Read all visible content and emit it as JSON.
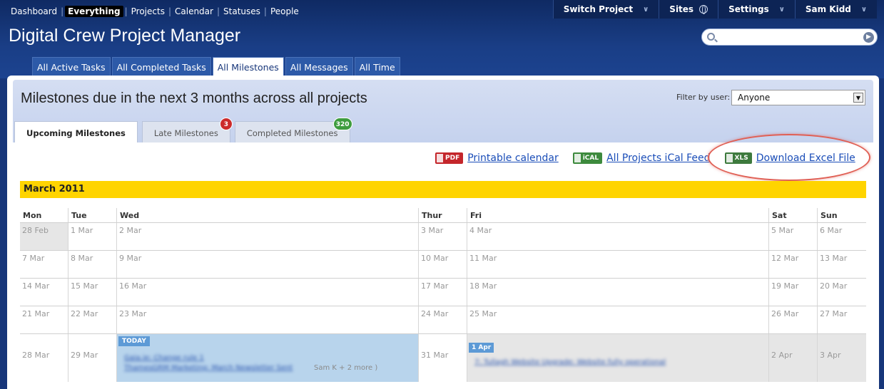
{
  "topnav": {
    "items": [
      "Dashboard",
      "Everything",
      "Projects",
      "Calendar",
      "Statuses",
      "People"
    ],
    "active_index": 1
  },
  "rightnav": {
    "switch_project": "Switch Project",
    "sites": "Sites",
    "settings": "Settings",
    "user": "Sam Kidd"
  },
  "app": {
    "title": "Digital Crew Project Manager"
  },
  "search": {
    "placeholder": ""
  },
  "tabs": [
    "All Active Tasks",
    "All Completed Tasks",
    "All Milestones",
    "All Messages",
    "All Time"
  ],
  "active_tab": 2,
  "page": {
    "title": "Milestones due in the next 3 months across all projects",
    "filter_label": "Filter by user:",
    "filter_value": "Anyone"
  },
  "subtabs": [
    {
      "label": "Upcoming Milestones",
      "badge": ""
    },
    {
      "label": "Late Milestones",
      "badge": "3"
    },
    {
      "label": "Completed Milestones",
      "badge": "320"
    }
  ],
  "links": {
    "pdf_icon": "PDF",
    "pdf_label": "Printable calendar",
    "ical_icon": "iCAL",
    "ical_label": "All Projects iCal Feed",
    "xls_icon": "XLS",
    "xls_label": "Download Excel File"
  },
  "calendar": {
    "month": "March 2011",
    "weekdays": [
      "Mon",
      "Tue",
      "Wed",
      "Thur",
      "Fri",
      "Sat",
      "Sun"
    ],
    "weeks": [
      [
        "28 Feb",
        "1 Mar",
        "2 Mar",
        "3 Mar",
        "4 Mar",
        "5 Mar",
        "6 Mar"
      ],
      [
        "7 Mar",
        "8 Mar",
        "9 Mar",
        "10 Mar",
        "11 Mar",
        "12 Mar",
        "13 Mar"
      ],
      [
        "14 Mar",
        "15 Mar",
        "16 Mar",
        "17 Mar",
        "18 Mar",
        "19 Mar",
        "20 Mar"
      ],
      [
        "21 Mar",
        "22 Mar",
        "23 Mar",
        "24 Mar",
        "25 Mar",
        "26 Mar",
        "27 Mar"
      ],
      [
        "28 Mar",
        "29 Mar",
        "",
        "31 Mar",
        "",
        "2 Apr",
        "3 Apr"
      ]
    ],
    "today_label": "TODAY",
    "apr_label": "1 Apr",
    "today_items": [
      "Gaia.ie: Change rule 1",
      "ThamesGRM Marketing: March Newsletter Sent"
    ],
    "today_more": "Sam K + 2 more )",
    "apr_item": "7: Tullagh Website Upgrade: Website fully operational"
  },
  "colors": {
    "header_bg": "#1a3e86",
    "month_bar": "#ffd400",
    "today_bg": "#b8d4ec",
    "highlight": "#e06055"
  }
}
